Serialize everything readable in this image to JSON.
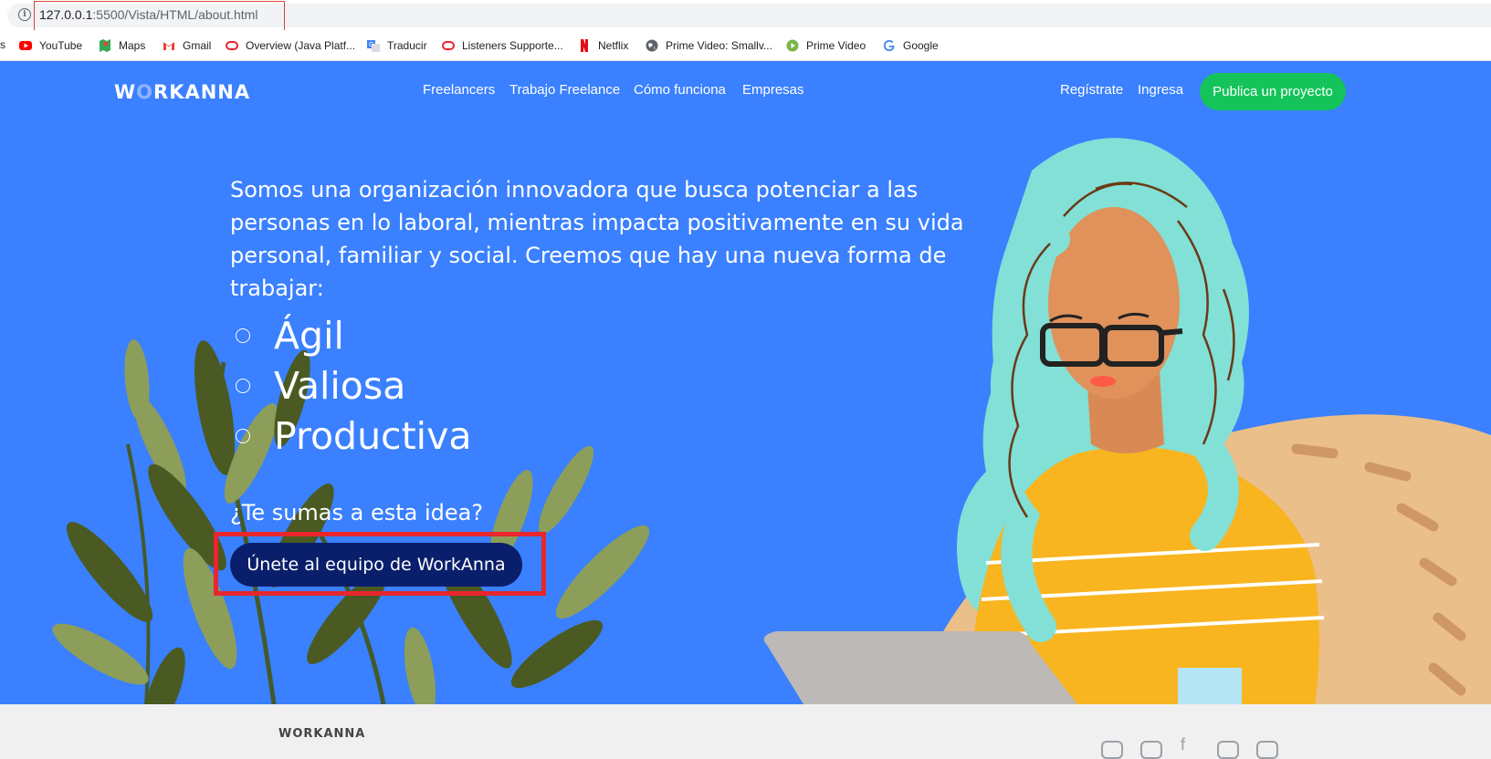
{
  "browser": {
    "url_host": "127.0.0.1",
    "url_rest": ":5500/Vista/HTML/about.html"
  },
  "bookmarks": {
    "cut_label": "s",
    "items": [
      {
        "label": "YouTube",
        "icon": "youtube-icon"
      },
      {
        "label": "Maps",
        "icon": "maps-icon"
      },
      {
        "label": "Gmail",
        "icon": "gmail-icon"
      },
      {
        "label": "Overview (Java Platf...",
        "icon": "oracle-icon"
      },
      {
        "label": "Traducir",
        "icon": "translate-icon"
      },
      {
        "label": "Listeners Supporte...",
        "icon": "oracle-icon"
      },
      {
        "label": "Netflix",
        "icon": "netflix-icon"
      },
      {
        "label": "Prime Video: Smallv...",
        "icon": "globe-icon"
      },
      {
        "label": "Prime Video",
        "icon": "prime-video-icon"
      },
      {
        "label": "Google",
        "icon": "google-icon"
      }
    ]
  },
  "header": {
    "logo": "WORKANNA",
    "nav": [
      "Freelancers",
      "Trabajo Freelance",
      "Cómo funciona",
      "Empresas"
    ],
    "register": "Regístrate",
    "login": "Ingresa",
    "cta": "Publica un proyecto"
  },
  "main": {
    "intro": "Somos una organización innovadora que busca potenciar a las personas en lo laboral, mientras impacta positivamente en su vida personal, familiar y social. Creemos que hay una nueva forma de trabajar:",
    "values": [
      "Ágil",
      "Valiosa",
      "Productiva"
    ],
    "question": "¿Te sumas a esta idea?",
    "join_button": "Únete al equipo de WorkAnna"
  },
  "footer": {
    "logo": "WORKANNA"
  },
  "colors": {
    "hero_bg": "#3a80ff",
    "cta_green": "#14c45a",
    "join_navy": "#0a1f6b",
    "highlight_red": "#e8262d"
  }
}
